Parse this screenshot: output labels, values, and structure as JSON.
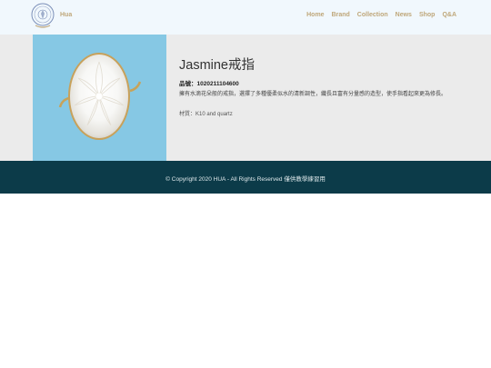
{
  "header": {
    "brand_name": "Hua",
    "nav": [
      "Home",
      "Brand",
      "Collection",
      "News",
      "Shop",
      "Q&A"
    ]
  },
  "product": {
    "title": "Jasmine戒指",
    "code": "品號：1020211104600",
    "description": "擁有水滴花朵般的戒指，選擇了多種優柔似水的清新調性，纖長且富有分量感的造型，使手指看起來更為修長。",
    "material": "材質：K10 and quartz"
  },
  "footer": {
    "copyright": "© Copyright 2020 HUA - All Rights Reserved 僅供教學練習用"
  },
  "colors": {
    "header_bg": "#f1f8fd",
    "nav_text": "#bfa77a",
    "product_bg": "#ebebeb",
    "image_bg": "#86c8e4",
    "footer_bg": "#0c3b49"
  }
}
